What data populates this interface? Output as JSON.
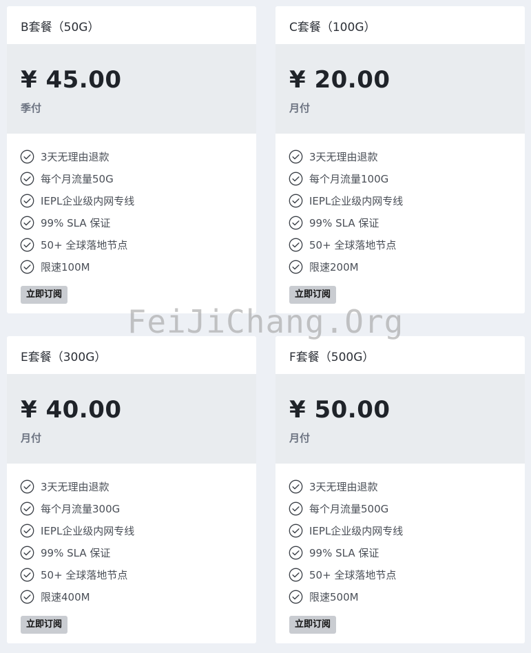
{
  "plans": [
    {
      "title": "B套餐（50G）",
      "price": "¥ 45.00",
      "period": "季付",
      "features": [
        "3天无理由退款",
        "每个月流量50G",
        "IEPL企业级内网专线",
        "99% SLA 保证",
        "50+ 全球落地节点",
        "限速100M"
      ],
      "button": "立即订阅"
    },
    {
      "title": "C套餐（100G）",
      "price": "¥ 20.00",
      "period": "月付",
      "features": [
        "3天无理由退款",
        "每个月流量100G",
        "IEPL企业级内网专线",
        "99% SLA 保证",
        "50+ 全球落地节点",
        "限速200M"
      ],
      "button": "立即订阅"
    },
    {
      "title": "E套餐（300G）",
      "price": "¥ 40.00",
      "period": "月付",
      "features": [
        "3天无理由退款",
        "每个月流量300G",
        "IEPL企业级内网专线",
        "99% SLA 保证",
        "50+ 全球落地节点",
        "限速400M"
      ],
      "button": "立即订阅"
    },
    {
      "title": "F套餐（500G）",
      "price": "¥ 50.00",
      "period": "月付",
      "features": [
        "3天无理由退款",
        "每个月流量500G",
        "IEPL企业级内网专线",
        "99% SLA 保证",
        "50+ 全球落地节点",
        "限速500M"
      ],
      "button": "立即订阅"
    }
  ],
  "watermark": "FeiJiChang.Org",
  "icons": {
    "feature": "check-circle-icon"
  },
  "colors": {
    "background": "#edf0f5",
    "price_box": "#e9ecef",
    "button": "#c9ccd1"
  }
}
